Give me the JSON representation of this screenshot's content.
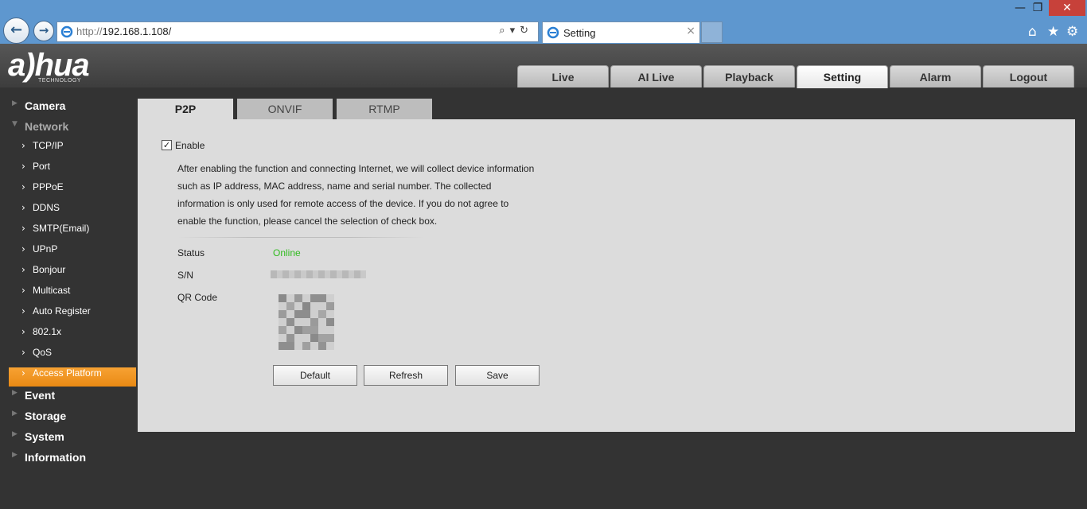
{
  "browser": {
    "url_protocol": "http://",
    "url_host": "192.168.1.108/",
    "tab_title": "Setting",
    "tab_close": "×",
    "address_tools": "⌕▾↻",
    "back_glyph": "←",
    "forward_glyph": "→",
    "minimize_glyph": "—",
    "restore_glyph": "❐",
    "close_glyph": "✕",
    "home_glyph": "⌂",
    "favorites_glyph": "★",
    "tools_glyph": "⚙"
  },
  "logo": {
    "text": "a)hua",
    "subtitle": "TECHNOLOGY"
  },
  "main_tabs": [
    {
      "label": "Live"
    },
    {
      "label": "AI Live"
    },
    {
      "label": "Playback"
    },
    {
      "label": "Setting",
      "active": true
    },
    {
      "label": "Alarm"
    },
    {
      "label": "Logout"
    }
  ],
  "sidebar": {
    "camera": "Camera",
    "network": "Network",
    "network_items": [
      "TCP/IP",
      "Port",
      "PPPoE",
      "DDNS",
      "SMTP(Email)",
      "UPnP",
      "Bonjour",
      "Multicast",
      "Auto Register",
      "802.1x",
      "QoS",
      "Access Platform"
    ],
    "active_item": "Access Platform",
    "event": "Event",
    "storage": "Storage",
    "system": "System",
    "information": "Information"
  },
  "sub_tabs": [
    "P2P",
    "ONVIF",
    "RTMP"
  ],
  "p2p": {
    "enable_label": "Enable",
    "enabled": true,
    "notice_lines": [
      "After enabling the function and connecting Internet, we will collect device information",
      "such as IP address, MAC address, name and serial number. The collected",
      "information is only used for remote access of the device. If you do not agree to",
      "enable the function, please cancel the selection of check box."
    ],
    "status_label": "Status",
    "status_value": "Online",
    "sn_label": "S/N",
    "qr_label": "QR Code",
    "buttons": {
      "default": "Default",
      "refresh": "Refresh",
      "save": "Save"
    }
  },
  "colors": {
    "online": "#33bb22",
    "active_item": "#f09a26"
  }
}
